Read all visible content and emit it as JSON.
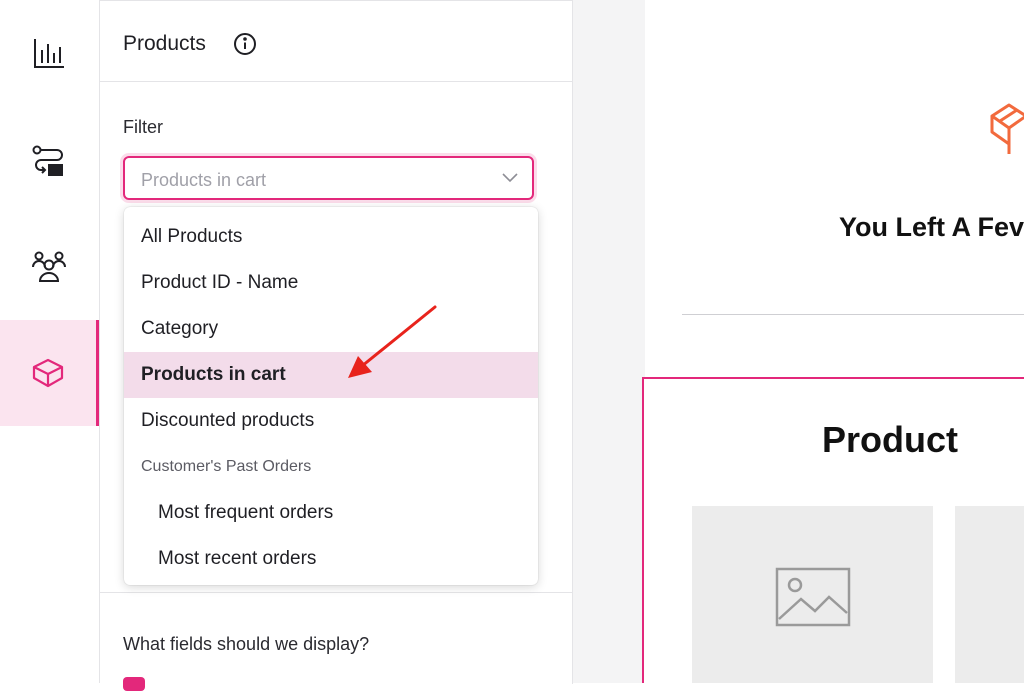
{
  "panel": {
    "title": "Products",
    "filter_label": "Filter",
    "filter_value": "Products in cart",
    "fields_label": "What fields should we display?"
  },
  "menu": {
    "items": [
      {
        "label": "All Products"
      },
      {
        "label": "Product ID - Name"
      },
      {
        "label": "Category"
      },
      {
        "label": "Products in cart",
        "selected": true
      },
      {
        "label": "Discounted products"
      }
    ],
    "group_label": "Customer's Past Orders",
    "group_items": [
      {
        "label": "Most frequent orders"
      },
      {
        "label": "Most recent orders"
      }
    ]
  },
  "preview": {
    "heading": "You Left A Fev",
    "product_title": "Product"
  },
  "rail": {
    "items": [
      {
        "icon": "analytics-icon"
      },
      {
        "icon": "workflow-icon"
      },
      {
        "icon": "audience-icon"
      },
      {
        "icon": "product-box-icon",
        "active": true
      }
    ]
  },
  "colors": {
    "accent": "#e3287b",
    "accent_light": "#fbe4ef",
    "selected_row": "#f3dcea",
    "logo": "#f26a3d",
    "arrow": "#e8231c"
  }
}
